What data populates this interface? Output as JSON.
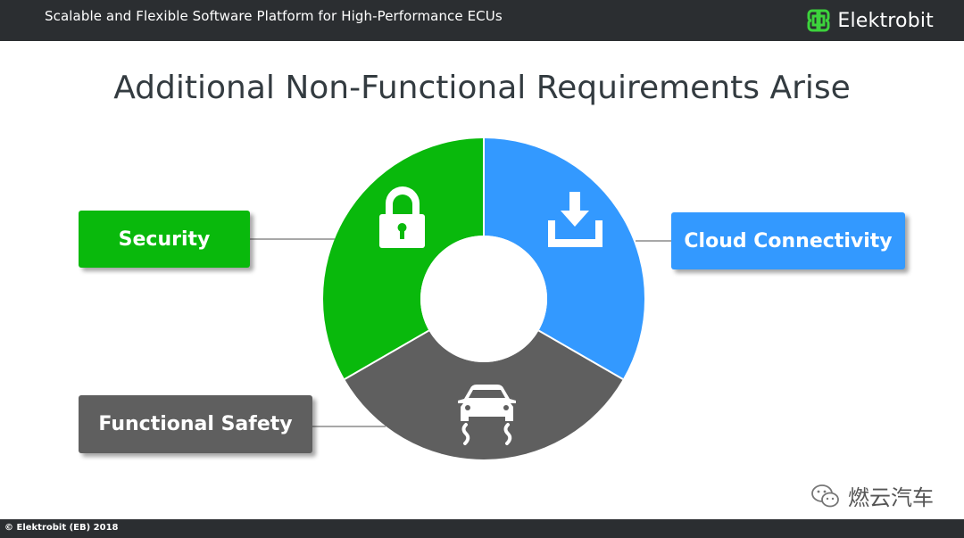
{
  "header": {
    "title": "Scalable and Flexible Software Platform for High-Performance ECUs",
    "brand_name": "Elektrobit",
    "brand_logo_icon": "elektrobit-logo-icon"
  },
  "slide": {
    "title": "Additional Non-Functional Requirements Arise"
  },
  "diagram": {
    "segments": [
      {
        "label": "Security",
        "icon": "padlock-icon",
        "color": "#09b90c"
      },
      {
        "label": "Cloud Connectivity",
        "icon": "download-tray-icon",
        "color": "#3399ff"
      },
      {
        "label": "Functional Safety",
        "icon": "car-skidding-icon",
        "color": "#5f5f5f"
      }
    ]
  },
  "watermark": {
    "text": "燃云汽车",
    "icon": "wechat-icon"
  },
  "footer": {
    "copyright": "© Elektrobit (EB) 2018"
  }
}
